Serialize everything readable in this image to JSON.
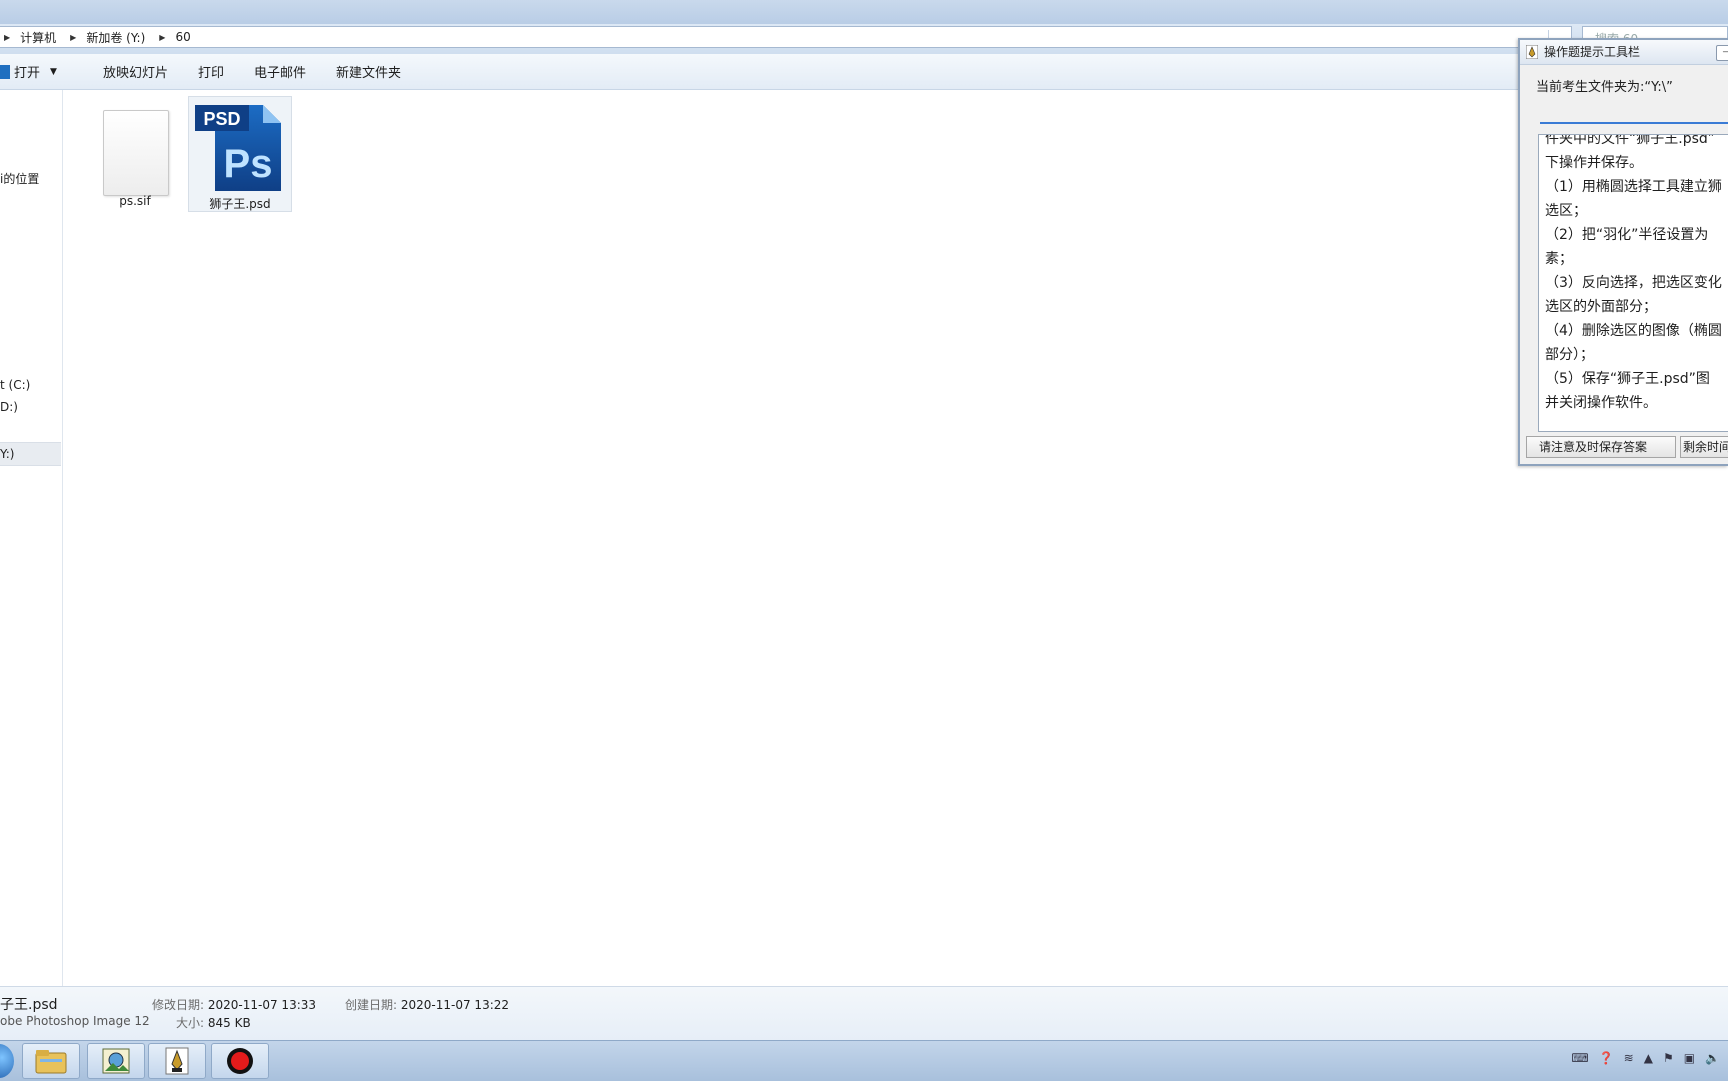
{
  "explorer": {
    "breadcrumb": [
      "计算机",
      "新加卷 (Y:)",
      "60"
    ],
    "search_placeholder": "搜索 60",
    "toolbar": {
      "open_label": "打开",
      "slideshow_label": "放映幻灯片",
      "print_label": "打印",
      "email_label": "电子邮件",
      "new_folder_label": "新建文件夹"
    },
    "nav": {
      "recent_places": "i的位置",
      "drive_c": "t (C:)",
      "drive_d": "D:)",
      "drive_y": "Y:)"
    },
    "files": [
      {
        "name": "ps.sif",
        "icon": "blank-file-icon"
      },
      {
        "name": "狮子王.psd",
        "icon": "photoshop-psd-icon"
      }
    ],
    "psd_icon_text": {
      "badge": "PSD",
      "logo": "Ps"
    },
    "details": {
      "file_name": "子王.psd",
      "file_type": "obe Photoshop Image 12",
      "modified_label": "修改日期:",
      "modified_value": "2020-11-07 13:33",
      "created_label": "创建日期:",
      "created_value": "2020-11-07 13:22",
      "size_label": "大小:",
      "size_value": "845 KB"
    }
  },
  "hint_window": {
    "title": "操作题提示工具栏",
    "path_text": "当前考生文件夹为:“Y:\\”",
    "instructions": [
      "件夹中的文件“狮子王.psd”",
      "下操作并保存。",
      "（1）用椭圆选择工具建立狮",
      "选区；",
      "（2）把“羽化”半径设置为",
      "素；",
      "（3）反向选择，把选区变化",
      "选区的外面部分；",
      "（4）删除选区的图像（椭圆",
      "部分）；",
      "（5）保存“狮子王.psd”图",
      "并关闭操作软件。"
    ],
    "save_notice_button": "请注意及时保存答案",
    "remaining_time_button": "剩余时间"
  },
  "taskbar": {
    "items": [
      "explorer-icon",
      "image-viewer-icon",
      "pen-tool-icon",
      "record-icon"
    ]
  },
  "colors": {
    "ps_blue_dark": "#0f3f86",
    "ps_blue": "#1c6cc4",
    "ps_text": "#bfe3ff",
    "accent_line": "#3a7bd5",
    "record_red": "#e31b1b"
  }
}
